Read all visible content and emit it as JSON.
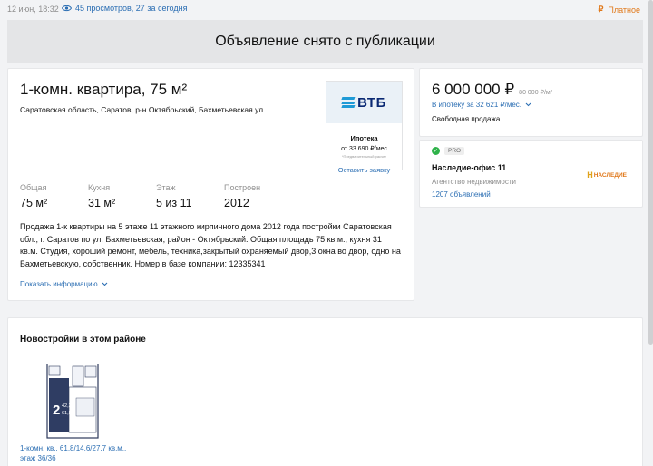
{
  "topbar": {
    "date": "12 июн, 18:32",
    "views": "45 просмотров, 27 за сегодня",
    "paid_label": "Платное",
    "paid_icon": "ruble-icon",
    "accent": "#e0781a"
  },
  "banner": {
    "text": "Объявление снято с публикации"
  },
  "listing": {
    "title": "1-комн. квартира, 75 м²",
    "address": "Саратовская область, Саратов, р-н Октябрьский, Бахметьевская ул.",
    "specs": [
      {
        "label": "Общая",
        "value": "75 м²"
      },
      {
        "label": "Кухня",
        "value": "31 м²"
      },
      {
        "label": "Этаж",
        "value": "5 из 11"
      },
      {
        "label": "Построен",
        "value": "2012"
      }
    ],
    "description": "Продажа 1-к квартиры на 5 этаже 11 этажного кирпичного дома 2012 года постройки Саратовская обл., г. Саратов по ул. Бахметьевская, район - Октябрьский. Общая площадь 75 кв.м., кухня 31 кв.м. Студия, хороший ремонт, мебель, техника,закрытый охраняемый двор,3 окна во двор, одно на Бахметьевскую, собственник. Номер в базе компании: 12335341",
    "show_more": "Показать информацию"
  },
  "bank": {
    "logo_text": "ВТБ",
    "mortgage_label": "Ипотека",
    "mortgage_from": "от 33 690 ₽/мес",
    "note": "*Предварительный расчет",
    "apply": "Оставить заявку",
    "brand_color": "#0a2973"
  },
  "price": {
    "amount": "6 000 000 ₽",
    "per_meter": "80 000 ₽/м²",
    "mortgage_line": "В ипотеку за 32 621 ₽/мес.",
    "sale_type": "Свободная продажа"
  },
  "agent": {
    "badge": "PRO",
    "name": "Наследие-офис 11",
    "type": "Агентство недвижимости",
    "count": "1207 объявлений",
    "logo_letter": "Н",
    "logo_text": "НАСЛЕДИЕ"
  },
  "new_buildings": {
    "title": "Новостройки в этом районе",
    "plan_rooms": "2",
    "plan_area_1": "42,3",
    "plan_area_2": "61,8",
    "caption": "1-комн. кв., 61,8/14,6/27,7 кв.м., этаж 36/36"
  },
  "colors": {
    "link": "#2b6eb3",
    "muted": "#8f8f8f",
    "background": "#f2f3f5"
  }
}
